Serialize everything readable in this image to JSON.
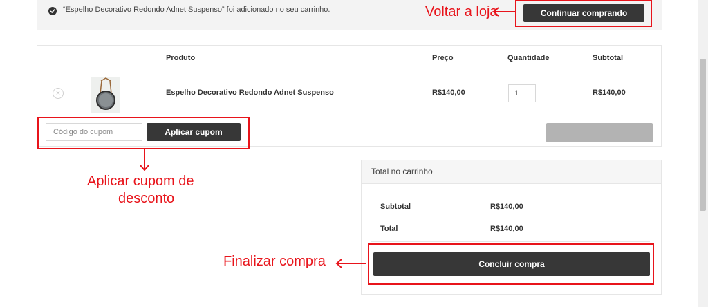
{
  "notice": {
    "message": "“Espelho Decorativo Redondo Adnet Suspenso” foi adicionado no seu carrinho.",
    "continue_label": "Continuar comprando"
  },
  "annotations": {
    "back_to_store": "Voltar a loja",
    "apply_coupon_line1": "Aplicar cupom de",
    "apply_coupon_line2": "desconto",
    "finish_purchase": "Finalizar compra",
    "accent_color": "#e8141b"
  },
  "cart": {
    "headers": {
      "product": "Produto",
      "price": "Preço",
      "quantity": "Quantidade",
      "subtotal": "Subtotal"
    },
    "items": [
      {
        "name": "Espelho Decorativo Redondo Adnet Suspenso",
        "price": "R$140,00",
        "quantity": "1",
        "subtotal": "R$140,00",
        "remove_icon": "close-icon",
        "image": "round-mirror-thumbnail"
      }
    ],
    "coupon": {
      "placeholder": "Código do cupom",
      "apply_label": "Aplicar cupom"
    }
  },
  "totals": {
    "title": "Total no carrinho",
    "rows": [
      {
        "label": "Subtotal",
        "value": "R$140,00"
      },
      {
        "label": "Total",
        "value": "R$140,00"
      }
    ],
    "checkout_label": "Concluir compra"
  },
  "colors": {
    "button_dark": "#373737",
    "button_disabled": "#b3b3b3",
    "notice_bg": "#f3f3f3"
  }
}
